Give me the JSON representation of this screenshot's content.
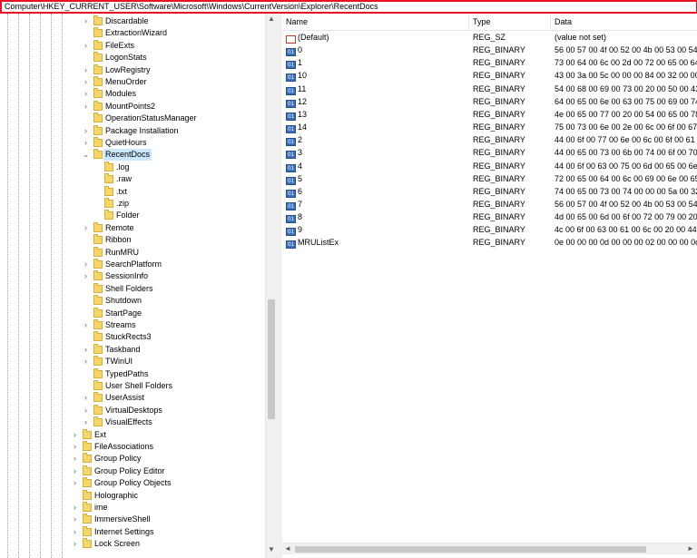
{
  "address_bar": {
    "path": "Computer\\HKEY_CURRENT_USER\\Software\\Microsoft\\Windows\\CurrentVersion\\Explorer\\RecentDocs"
  },
  "tree": {
    "items": [
      {
        "label": "Discardable",
        "level": 2,
        "expander": "›"
      },
      {
        "label": "ExtractionWizard",
        "level": 2,
        "expander": ""
      },
      {
        "label": "FileExts",
        "level": 2,
        "expander": "›"
      },
      {
        "label": "LogonStats",
        "level": 2,
        "expander": ""
      },
      {
        "label": "LowRegistry",
        "level": 2,
        "expander": "›"
      },
      {
        "label": "MenuOrder",
        "level": 2,
        "expander": "›"
      },
      {
        "label": "Modules",
        "level": 2,
        "expander": "›"
      },
      {
        "label": "MountPoints2",
        "level": 2,
        "expander": "›"
      },
      {
        "label": "OperationStatusManager",
        "level": 2,
        "expander": ""
      },
      {
        "label": "Package Installation",
        "level": 2,
        "expander": "›"
      },
      {
        "label": "QuietHours",
        "level": 2,
        "expander": "›"
      },
      {
        "label": "RecentDocs",
        "level": 2,
        "expander": "⌄",
        "selected": true
      },
      {
        "label": ".log",
        "level": 3,
        "expander": ""
      },
      {
        "label": ".raw",
        "level": 3,
        "expander": ""
      },
      {
        "label": ".txt",
        "level": 3,
        "expander": ""
      },
      {
        "label": ".zip",
        "level": 3,
        "expander": ""
      },
      {
        "label": "Folder",
        "level": 3,
        "expander": ""
      },
      {
        "label": "Remote",
        "level": 2,
        "expander": "›"
      },
      {
        "label": "Ribbon",
        "level": 2,
        "expander": ""
      },
      {
        "label": "RunMRU",
        "level": 2,
        "expander": ""
      },
      {
        "label": "SearchPlatform",
        "level": 2,
        "expander": "›"
      },
      {
        "label": "SessionInfo",
        "level": 2,
        "expander": "›"
      },
      {
        "label": "Shell Folders",
        "level": 2,
        "expander": ""
      },
      {
        "label": "Shutdown",
        "level": 2,
        "expander": ""
      },
      {
        "label": "StartPage",
        "level": 2,
        "expander": ""
      },
      {
        "label": "Streams",
        "level": 2,
        "expander": "›"
      },
      {
        "label": "StuckRects3",
        "level": 2,
        "expander": ""
      },
      {
        "label": "Taskband",
        "level": 2,
        "expander": "›"
      },
      {
        "label": "TWinUI",
        "level": 2,
        "expander": "›"
      },
      {
        "label": "TypedPaths",
        "level": 2,
        "expander": ""
      },
      {
        "label": "User Shell Folders",
        "level": 2,
        "expander": ""
      },
      {
        "label": "UserAssist",
        "level": 2,
        "expander": "›"
      },
      {
        "label": "VirtualDesktops",
        "level": 2,
        "expander": "›"
      },
      {
        "label": "VisualEffects",
        "level": 2,
        "expander": "›"
      },
      {
        "label": "Ext",
        "level": 1,
        "expander": "›"
      },
      {
        "label": "FileAssociations",
        "level": 1,
        "expander": "›"
      },
      {
        "label": "Group Policy",
        "level": 1,
        "expander": "›"
      },
      {
        "label": "Group Policy Editor",
        "level": 1,
        "expander": "›"
      },
      {
        "label": "Group Policy Objects",
        "level": 1,
        "expander": "›"
      },
      {
        "label": "Holographic",
        "level": 1,
        "expander": ""
      },
      {
        "label": "ime",
        "level": 1,
        "expander": "›"
      },
      {
        "label": "ImmersiveShell",
        "level": 1,
        "expander": "›"
      },
      {
        "label": "Internet Settings",
        "level": 1,
        "expander": "›"
      },
      {
        "label": "Lock Screen",
        "level": 1,
        "expander": "›"
      }
    ]
  },
  "values": {
    "columns": {
      "name": "Name",
      "type": "Type",
      "data": "Data"
    },
    "rows": [
      {
        "name": "(Default)",
        "type": "REG_SZ",
        "data": "(value not set)",
        "icon": "string-value-icon",
        "icon_glyph": "ab"
      },
      {
        "name": "0",
        "type": "REG_BINARY",
        "data": "56 00 57 00 4f 00 52 00 4b 00 53 00 54 00",
        "icon": "binary-value-icon",
        "icon_glyph": "01"
      },
      {
        "name": "1",
        "type": "REG_BINARY",
        "data": "73 00 64 00 6c 00 2d 00 72 00 65 00 64 0",
        "icon": "binary-value-icon",
        "icon_glyph": "01"
      },
      {
        "name": "10",
        "type": "REG_BINARY",
        "data": "43 00 3a 00 5c 00 00 00 84 00 32 00 00 0",
        "icon": "binary-value-icon",
        "icon_glyph": "01"
      },
      {
        "name": "11",
        "type": "REG_BINARY",
        "data": "54 00 68 00 69 00 73 00 20 00 50 00 43 0",
        "icon": "binary-value-icon",
        "icon_glyph": "01"
      },
      {
        "name": "12",
        "type": "REG_BINARY",
        "data": "64 00 65 00 6e 00 63 00 75 00 69 00 74 0",
        "icon": "binary-value-icon",
        "icon_glyph": "01"
      },
      {
        "name": "13",
        "type": "REG_BINARY",
        "data": "4e 00 65 00 77 00 20 00 54 00 65 00 78 0",
        "icon": "binary-value-icon",
        "icon_glyph": "01"
      },
      {
        "name": "14",
        "type": "REG_BINARY",
        "data": "75 00 73 00 6e 00 2e 00 6c 00 6f 00 67 0",
        "icon": "binary-value-icon",
        "icon_glyph": "01"
      },
      {
        "name": "2",
        "type": "REG_BINARY",
        "data": "44 00 6f 00 77 00 6e 00 6c 00 6f 00 61 0",
        "icon": "binary-value-icon",
        "icon_glyph": "01"
      },
      {
        "name": "3",
        "type": "REG_BINARY",
        "data": "44 00 65 00 73 00 6b 00 74 00 6f 00 70 0",
        "icon": "binary-value-icon",
        "icon_glyph": "01"
      },
      {
        "name": "4",
        "type": "REG_BINARY",
        "data": "44 00 6f 00 63 00 75 00 6d 00 65 00 6e 0",
        "icon": "binary-value-icon",
        "icon_glyph": "01"
      },
      {
        "name": "5",
        "type": "REG_BINARY",
        "data": "72 00 65 00 64 00 6c 00 69 00 6e 00 65 0",
        "icon": "binary-value-icon",
        "icon_glyph": "01"
      },
      {
        "name": "6",
        "type": "REG_BINARY",
        "data": "74 00 65 00 73 00 74 00 00 00 5a 00 32 0",
        "icon": "binary-value-icon",
        "icon_glyph": "01"
      },
      {
        "name": "7",
        "type": "REG_BINARY",
        "data": "56 00 57 00 4f 00 52 00 4b 00 53 00 54 0",
        "icon": "binary-value-icon",
        "icon_glyph": "01"
      },
      {
        "name": "8",
        "type": "REG_BINARY",
        "data": "4d 00 65 00 6d 00 6f 00 72 00 79 00 20 0",
        "icon": "binary-value-icon",
        "icon_glyph": "01"
      },
      {
        "name": "9",
        "type": "REG_BINARY",
        "data": "4c 00 6f 00 63 00 61 00 6c 00 20 00 44 0",
        "icon": "binary-value-icon",
        "icon_glyph": "01"
      },
      {
        "name": "MRUListEx",
        "type": "REG_BINARY",
        "data": "0e 00 00 00 0d 00 00 00 02 00 00 00 0c 0",
        "icon": "binary-value-icon",
        "icon_glyph": "01"
      }
    ]
  },
  "scrollbars": {
    "up_arrow": "▲",
    "down_arrow": "▼",
    "left_arrow": "◄",
    "right_arrow": "►"
  },
  "colors": {
    "address_border": "#e81123",
    "selection_bg": "#cce8ff",
    "folder_fill": "#f5d66b"
  }
}
